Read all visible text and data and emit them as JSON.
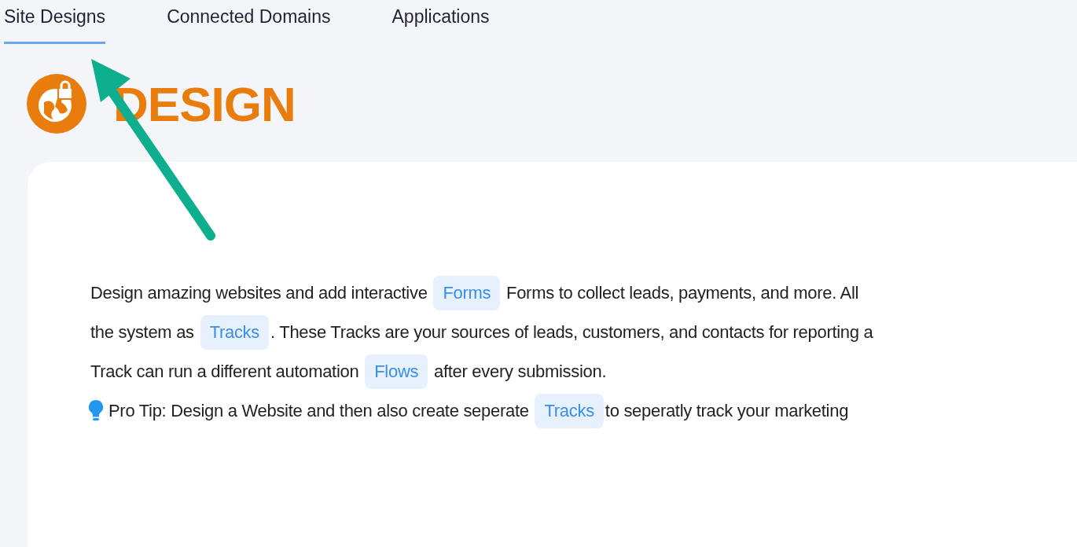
{
  "tabs": [
    {
      "label": "Site Designs",
      "selected": true
    },
    {
      "label": "Connected Domains",
      "selected": false
    },
    {
      "label": "Applications",
      "selected": false
    }
  ],
  "header": {
    "title": "DESIGN"
  },
  "description": {
    "lines": [
      [
        {
          "kind": "text",
          "text": "Design amazing websites and add interactive "
        },
        {
          "kind": "chip",
          "text": "Forms"
        },
        {
          "kind": "text",
          "text": " Forms to collect leads, payments, and more. All"
        }
      ],
      [
        {
          "kind": "text",
          "text": "the system as "
        },
        {
          "kind": "chip",
          "text": "Tracks"
        },
        {
          "kind": "text",
          "text": ". These Tracks are your sources of leads, customers, and contacts for reporting a"
        }
      ],
      [
        {
          "kind": "text",
          "text": "Track can run a different automation "
        },
        {
          "kind": "chip",
          "text": "Flows"
        },
        {
          "kind": "text",
          "text": " after every submission."
        }
      ]
    ]
  },
  "tip": {
    "segments": [
      {
        "kind": "text",
        "text": "Pro Tip: Design a Website and then also create seperate "
      },
      {
        "kind": "chip",
        "text": "Tracks"
      },
      {
        "kind": "text",
        "text": "to seperatly track your marketing"
      }
    ]
  }
}
